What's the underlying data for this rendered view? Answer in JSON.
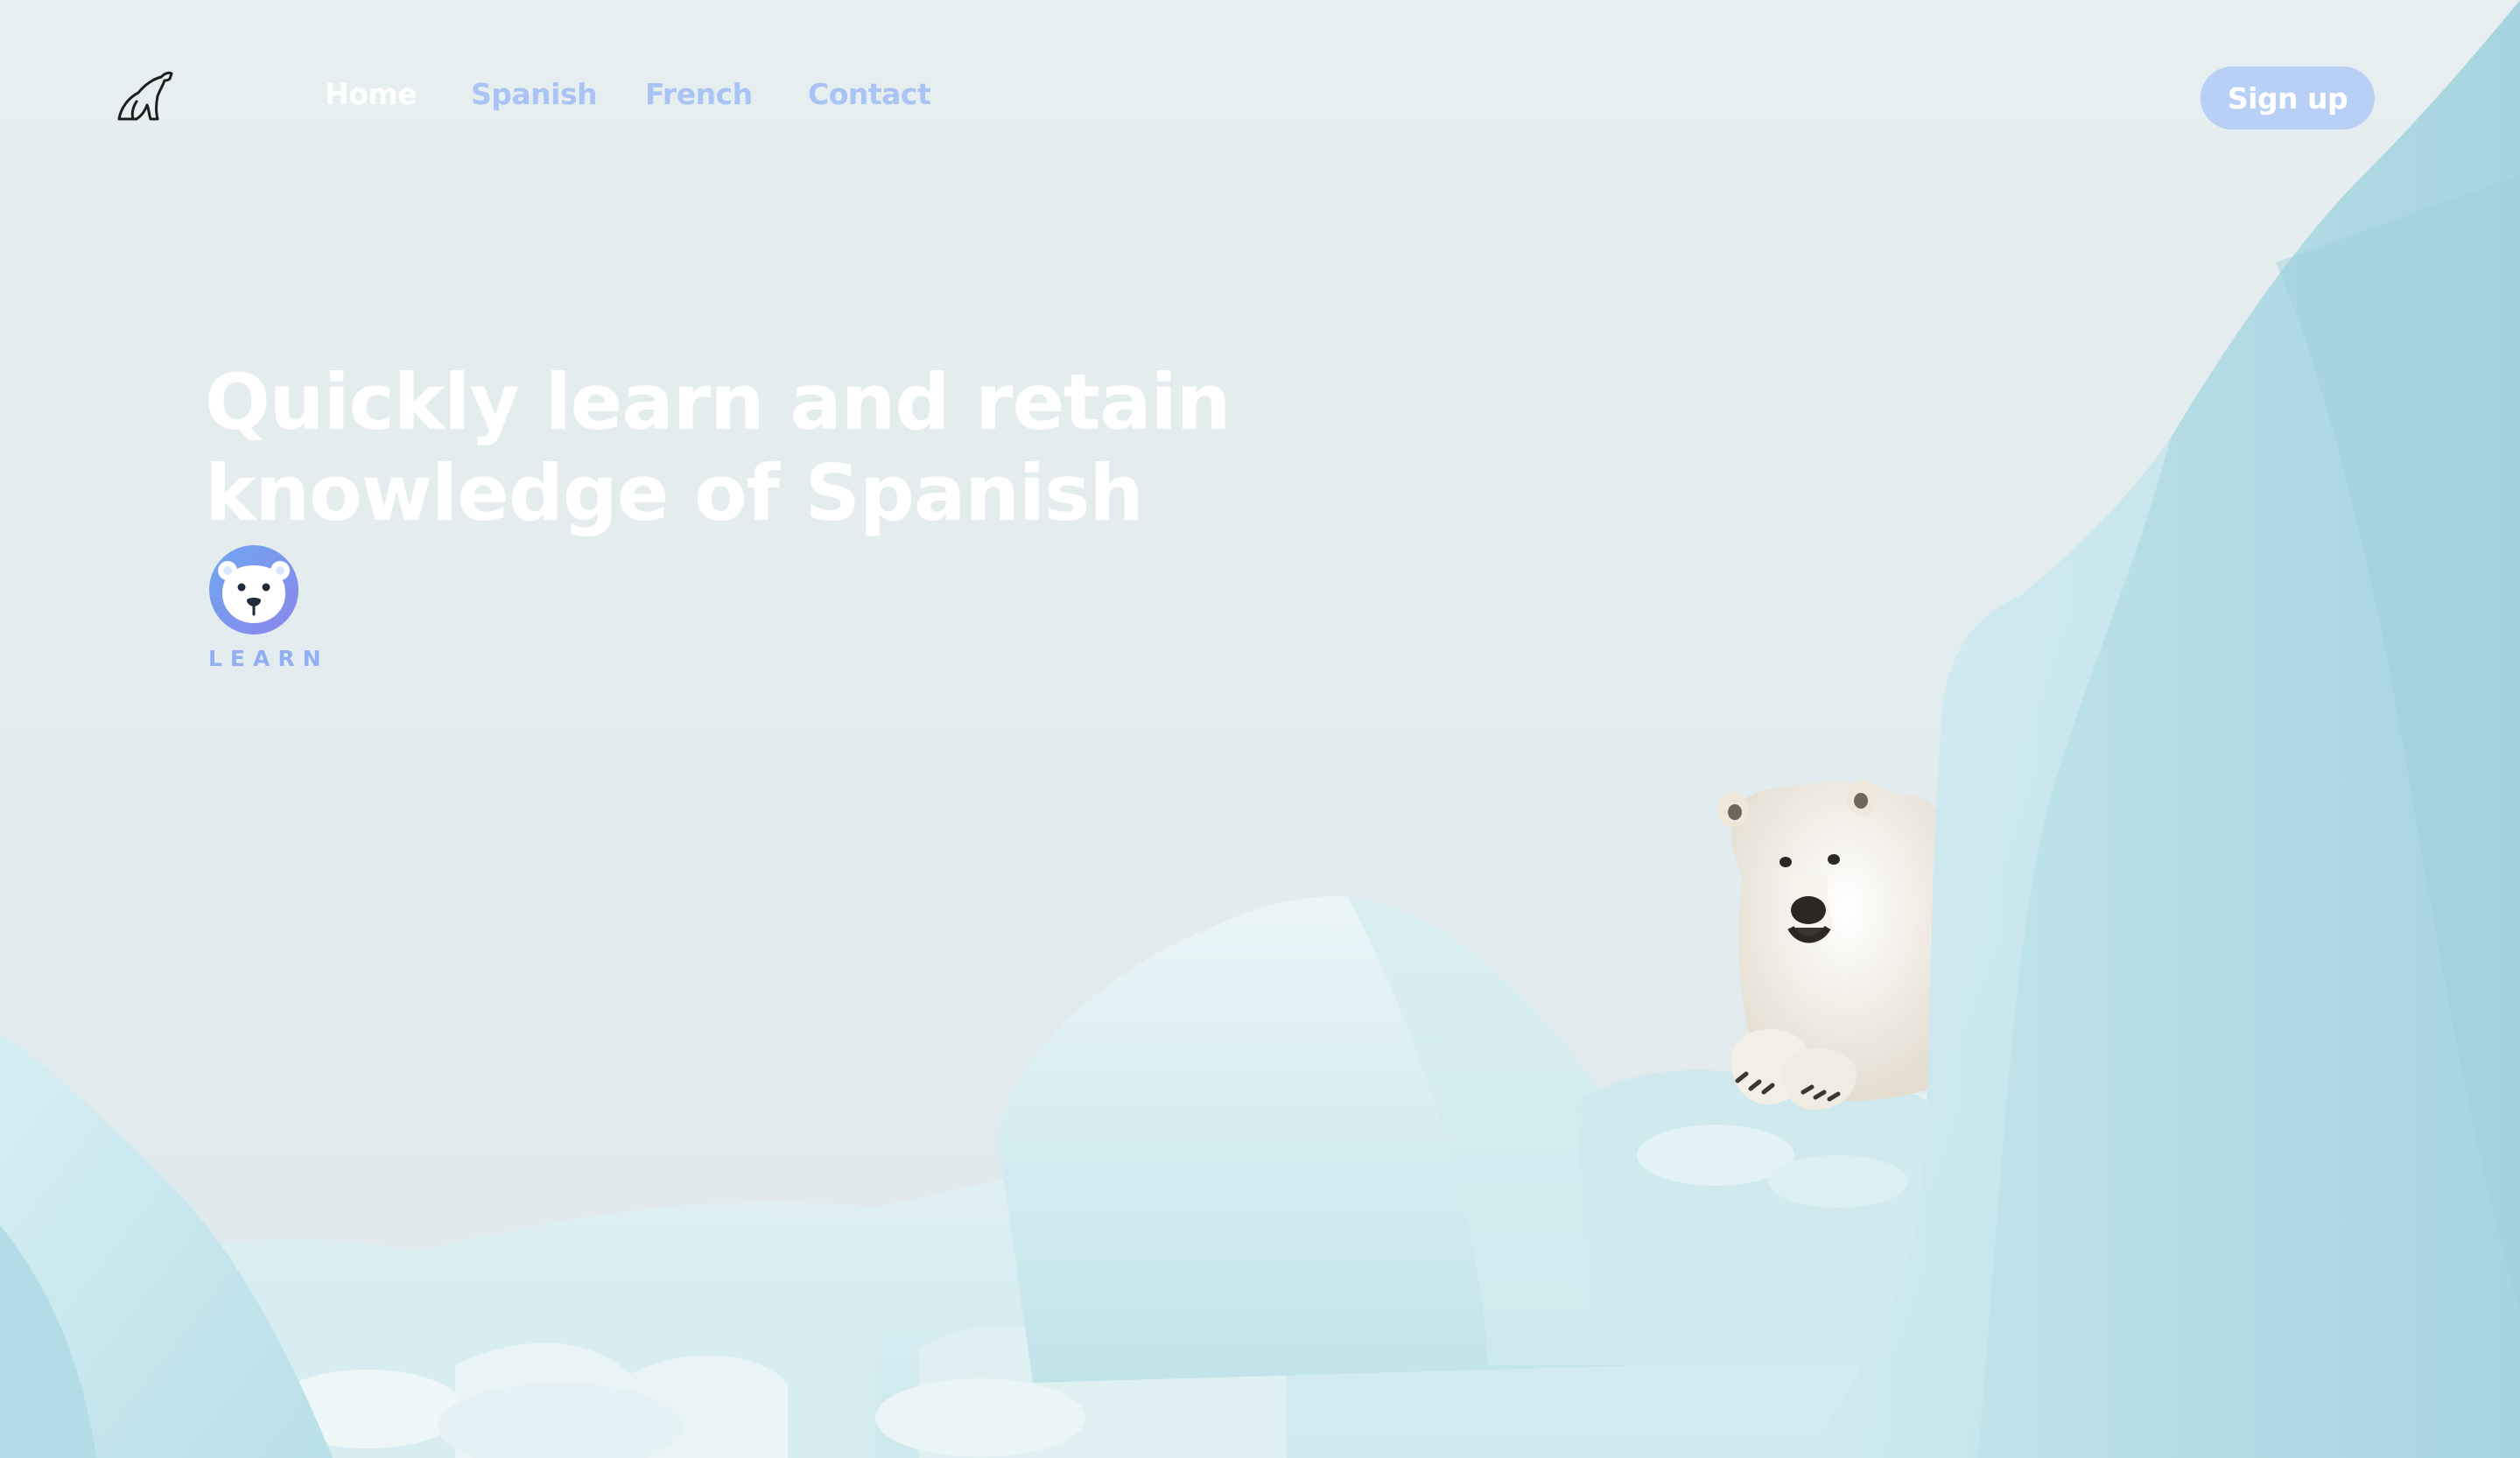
{
  "nav": {
    "logo_icon": "polar-bear-logo-icon",
    "links": [
      {
        "label": "Home",
        "active": true
      },
      {
        "label": "Spanish",
        "active": false
      },
      {
        "label": "French",
        "active": false
      },
      {
        "label": "Contact",
        "active": false
      }
    ],
    "signup_label": "Sign up"
  },
  "hero": {
    "title_line1": "Quickly learn and retain",
    "title_line2": "knowledge of Spanish",
    "badge_icon": "bear-face-icon",
    "badge_word": "LEARN"
  },
  "background": {
    "icon": "polar-bear-on-ice-illustration"
  },
  "colors": {
    "accent": "#a9c3f4",
    "button": "#b8cff6",
    "badge": "#7f9ff0",
    "sky": "#e6eeef",
    "ice": "#bfe3ea"
  }
}
